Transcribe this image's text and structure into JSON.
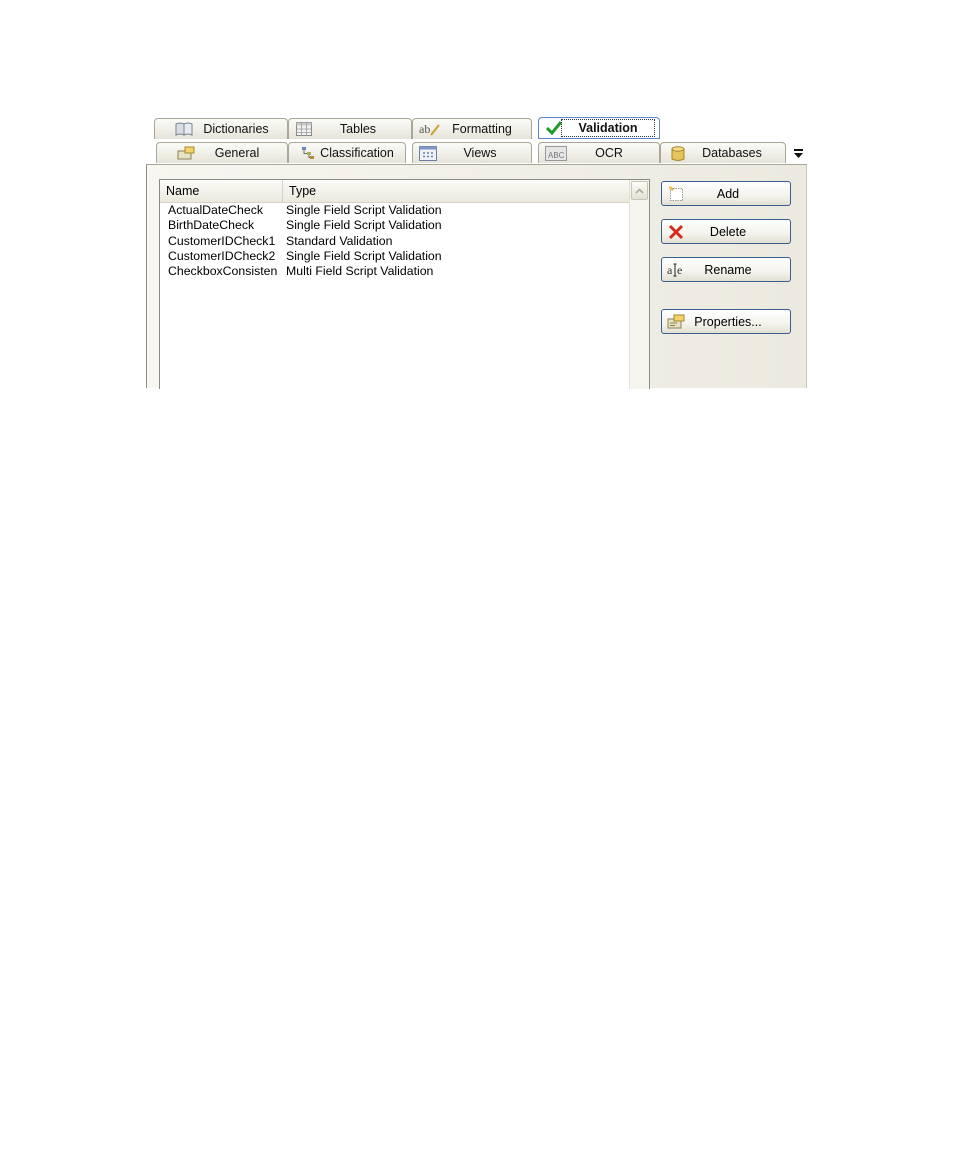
{
  "tabs_top": [
    {
      "label": "Dictionaries",
      "icon": "book-icon"
    },
    {
      "label": "Tables",
      "icon": "table-icon"
    },
    {
      "label": "Formatting",
      "icon": "spelling-icon"
    },
    {
      "label": "Validation",
      "icon": "checkmark-icon",
      "active": true
    }
  ],
  "tabs_bottom": [
    {
      "label": "General",
      "icon": "general-icon"
    },
    {
      "label": "Classification",
      "icon": "classification-icon"
    },
    {
      "label": "Views",
      "icon": "views-icon"
    },
    {
      "label": "OCR",
      "icon": "ocr-icon"
    },
    {
      "label": "Databases",
      "icon": "database-icon"
    }
  ],
  "list": {
    "columns": [
      "Name",
      "Type"
    ],
    "rows": [
      {
        "name": "ActualDateCheck",
        "type": "Single Field Script Validation"
      },
      {
        "name": "BirthDateCheck",
        "type": "Single Field Script Validation"
      },
      {
        "name": "CustomerIDCheck1",
        "type": "Standard Validation"
      },
      {
        "name": "CustomerIDCheck2",
        "type": "Single Field Script Validation"
      },
      {
        "name": "CheckboxConsisten",
        "type": "Multi Field Script Validation"
      }
    ]
  },
  "buttons": {
    "add": "Add",
    "delete": "Delete",
    "rename": "Rename",
    "properties": "Properties..."
  },
  "colors": {
    "button_border": "#3c5d8f",
    "delete_icon": "#d42a1c",
    "check_icon": "#1f9a2a"
  }
}
